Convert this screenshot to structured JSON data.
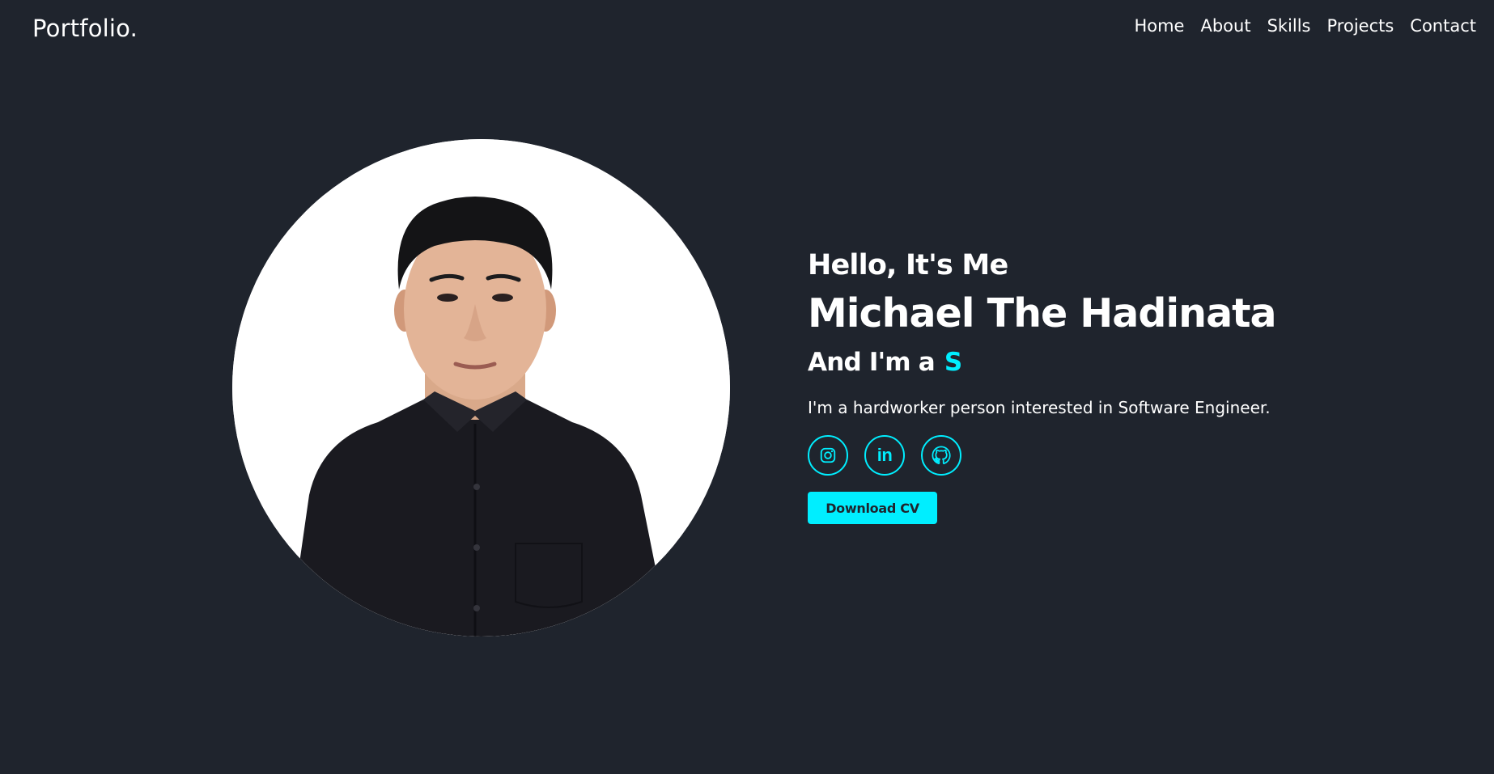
{
  "header": {
    "logo": "Portfolio.",
    "nav": [
      "Home",
      "About",
      "Skills",
      "Projects",
      "Contact"
    ]
  },
  "hero": {
    "greeting": "Hello, It's Me",
    "name": "Michael The Hadinata",
    "role_prefix": "And I'm a",
    "role_typed": "S",
    "description": "I'm a hardworker person interested in Software Engineer.",
    "socials": [
      {
        "icon": "instagram-icon"
      },
      {
        "icon": "linkedin-icon",
        "glyph": "in"
      },
      {
        "icon": "github-icon"
      }
    ],
    "cta_label": "Download CV"
  },
  "colors": {
    "background": "#1f242d",
    "accent": "#00eeff",
    "text": "#ffffff"
  }
}
